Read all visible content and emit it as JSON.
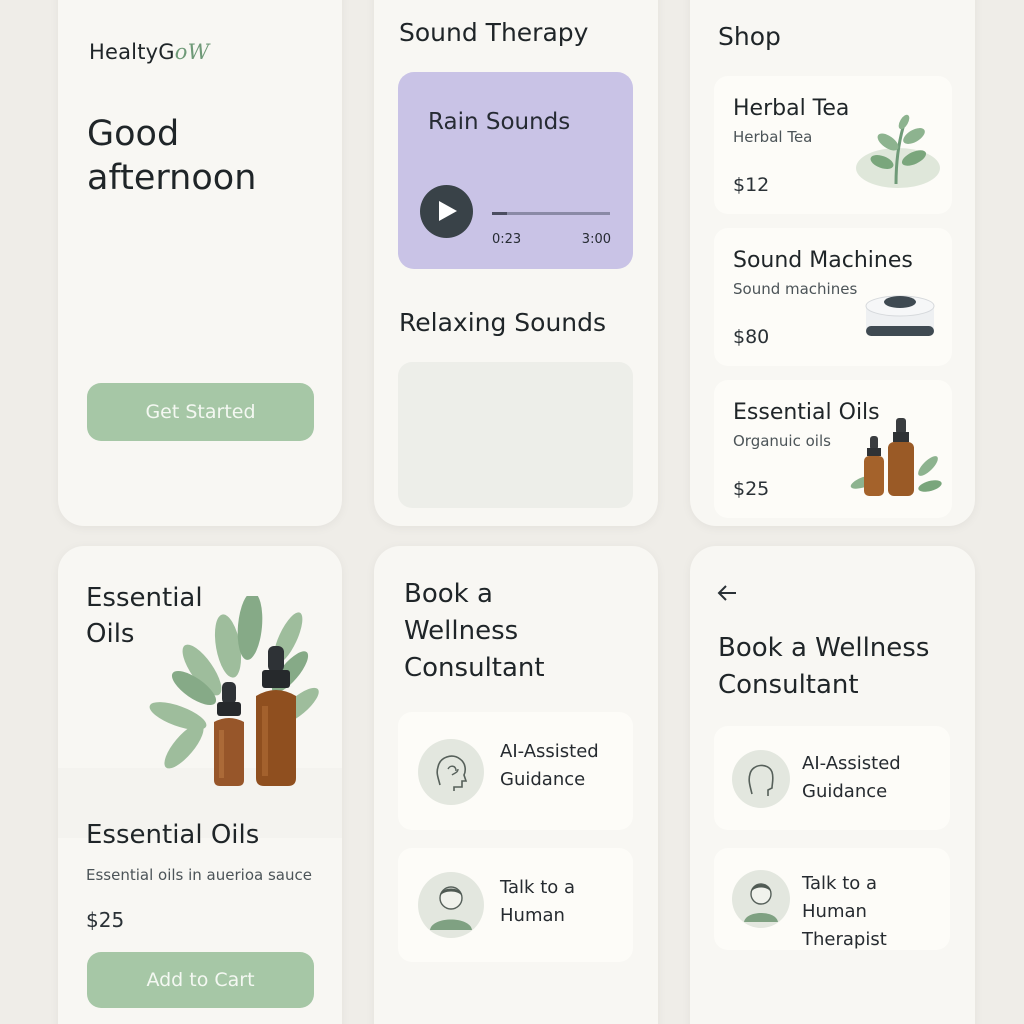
{
  "home": {
    "brand_main": "HealtyG",
    "brand_accent": "oW",
    "greeting_line1": "Good",
    "greeting_line2": "afternoon",
    "get_started_label": "Get Started"
  },
  "sound_therapy": {
    "title": "Sound Therapy",
    "player": {
      "track_name": "Rain Sounds",
      "current_time": "0:23",
      "total_time": "3:00",
      "progress_fraction": 0.128
    },
    "relaxing_title": "Relaxing Sounds"
  },
  "shop": {
    "title": "Shop",
    "items": [
      {
        "name": "Herbal Tea",
        "subtitle": "Herbal Tea",
        "price": "$12",
        "icon": "herbal-plant-icon"
      },
      {
        "name": "Sound Machines",
        "subtitle": "Sound machines",
        "price": "$80",
        "icon": "sound-machine-icon"
      },
      {
        "name": "Essential Oils",
        "subtitle": "Organuic oils",
        "price": "$25",
        "icon": "oil-bottles-icon"
      }
    ]
  },
  "product": {
    "hero_title_line1": "Essential",
    "hero_title_line2": "Oils",
    "name": "Essential Oils",
    "description": "Essential oils in auerioa sauce",
    "price": "$25",
    "add_to_cart_label": "Add to Cart"
  },
  "booking_a": {
    "title_line1": "Book a",
    "title_line2": "Wellness",
    "title_line3": "Consultant",
    "options": [
      {
        "line1": "AI-Assisted",
        "line2": "Guidance",
        "icon": "ai-head-icon"
      },
      {
        "line1": "Talk to a",
        "line2": "Human",
        "icon": "person-icon"
      }
    ]
  },
  "booking_b": {
    "title_line1": "Book a Wellness",
    "title_line2": "Consultant",
    "options": [
      {
        "line1": "AI-Assisted",
        "line2": "Guidance",
        "icon": "head-profile-icon"
      },
      {
        "line1": "Talk to a",
        "line2": "Human Therapist",
        "icon": "therapist-icon"
      }
    ]
  },
  "colors": {
    "background": "#efede8",
    "card": "#f8f7f3",
    "accent_green": "#a6c7a6",
    "player_lavender": "#c9c3e6",
    "text_dark": "#1f2528"
  }
}
